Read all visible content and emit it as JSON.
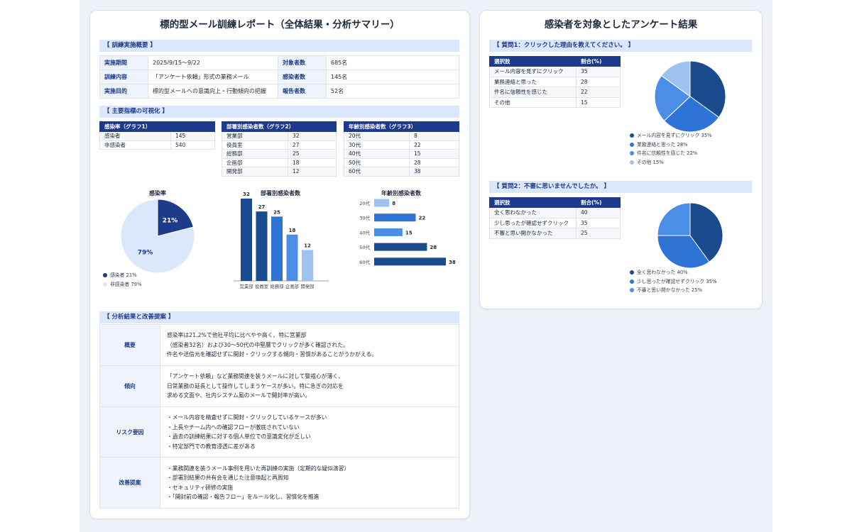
{
  "left": {
    "title": "標的型メール訓練レポート（全体結果・分析サマリー）",
    "overview": {
      "heading": "【 訓練実施概要 】",
      "rows": [
        {
          "k1": "実施期間",
          "v1": "2025/9/15〜9/22",
          "k2": "対象者数",
          "v2": "685名"
        },
        {
          "k1": "訓練内容",
          "v1": "「アンケート依頼」形式の業務メール",
          "k2": "感染者数",
          "v2": "145名"
        },
        {
          "k1": "実施目的",
          "v1": "標的型メールへの意識向上・行動傾向の把握",
          "k2": "報告者数",
          "v2": "52名"
        }
      ]
    },
    "indicators": {
      "heading": "【 主要指標の可視化 】",
      "t1": {
        "header": "感染率（グラフ1）",
        "rows": [
          [
            "感染者",
            "145"
          ],
          [
            "非感染者",
            "540"
          ]
        ]
      },
      "t2": {
        "header": "部署別感染者数（グラフ2）",
        "rows": [
          [
            "営業部",
            "32"
          ],
          [
            "役員室",
            "27"
          ],
          [
            "総務部",
            "25"
          ],
          [
            "企画部",
            "18"
          ],
          [
            "開発部",
            "12"
          ]
        ]
      },
      "t3": {
        "header": "年齢別感染者数（グラフ3）",
        "rows": [
          [
            "20代",
            "8"
          ],
          [
            "30代",
            "22"
          ],
          [
            "40代",
            "15"
          ],
          [
            "50代",
            "28"
          ],
          [
            "60代",
            "38"
          ]
        ]
      }
    },
    "pie_legend": [
      "感染者 21%",
      "非感染者 79%"
    ],
    "analysis": {
      "heading": "【 分析結果と改善提案 】",
      "rows": [
        {
          "k": "概要",
          "lines": [
            "感染率は21.2%で他社平均に比べやや高く、特に営業部",
            "（感染者32名）および30〜50代の中堅層でクリックが多く確認された。",
            "件名や送信元を確認せずに開封・クリックする傾向・習慣があることがうかがえる。"
          ]
        },
        {
          "k": "傾向",
          "lines": [
            "「アンケート依頼」など業務関連を装うメールに対して警戒心が薄く、",
            "日常業務の延長として操作してしまうケースが多い。特に急ぎの対応を",
            "求める文面や、社内システム風のメールで開封率が高い。"
          ]
        },
        {
          "k": "リスク要因",
          "lines": [
            "・メール内容を精査せずに開封・クリックしているケースが多い",
            "・上長やチーム内への確認フローが徹底されていない",
            "・過去の訓練結果に対する個人単位での意識変化が乏しい",
            "・特定部門での教育浸透に差がある"
          ]
        },
        {
          "k": "改善提案",
          "lines": [
            "・業務関連を装うメール事例を用いた再訓練の実施（定期的な疑似演習）",
            "・部署別結果の共有会を通じた注意喚起と再周知",
            "・セキュリティ研修の実施",
            "・「開封前の確認・報告フロー」をルール化し、習慣化を推進"
          ]
        }
      ]
    }
  },
  "right": {
    "title": "感染者を対象としたアンケート結果",
    "q1": {
      "heading": "【 質問1：クリックした理由を教えてください。 】",
      "cols": [
        "選択肢",
        "割合(%)"
      ],
      "rows": [
        [
          "メール内容を見ずにクリック",
          "35"
        ],
        [
          "業務連絡と思った",
          "28"
        ],
        [
          "件名に信頼性を感じた",
          "22"
        ],
        [
          "その他",
          "15"
        ]
      ],
      "legend": [
        "メール内容を見ずにクリック 35%",
        "業務連絡と思った 28%",
        "件名に信頼性を感じた 22%",
        "その他 15%"
      ]
    },
    "q2": {
      "heading": "【 質問2：不審に思いませんでしたか。 】",
      "cols": [
        "選択肢",
        "割合(%)"
      ],
      "rows": [
        [
          "全く思わなかった",
          "40"
        ],
        [
          "少し思ったが確認せずクリック",
          "35"
        ],
        [
          "不審と思い開かなかった",
          "25"
        ]
      ],
      "legend": [
        "全く思わなかった 40%",
        "少し思ったが確認せずクリック 35%",
        "不審と思い開かなかった 25%"
      ]
    }
  },
  "colors": {
    "navy": "#1e3a8a",
    "dark_blue": "#1a4b8f",
    "blue": "#2e74d6",
    "mid_blue": "#4a8ee6",
    "light_blue": "#9ec3f0",
    "pale_blue": "#dbe7fb"
  },
  "chart_data": [
    {
      "type": "pie",
      "title": "感染率",
      "labels": [
        "感染者",
        "非感染者"
      ],
      "values": [
        21,
        79
      ],
      "data_labels": [
        "21%",
        "79%"
      ]
    },
    {
      "type": "bar",
      "title": "部署別感染者数",
      "categories": [
        "営業部",
        "役員室",
        "総務部",
        "企画部",
        "開発部"
      ],
      "values": [
        32,
        27,
        25,
        18,
        12
      ]
    },
    {
      "type": "bar",
      "orientation": "horizontal",
      "title": "年齢別感染者数",
      "categories": [
        "20代",
        "30代",
        "40代",
        "50代",
        "60代"
      ],
      "values": [
        8,
        22,
        15,
        28,
        38
      ]
    },
    {
      "type": "pie",
      "labels": [
        "メール内容を見ずにクリック",
        "業務連絡と思った",
        "件名に信頼性を感じた",
        "その他"
      ],
      "values": [
        35,
        28,
        22,
        15
      ]
    },
    {
      "type": "pie",
      "labels": [
        "全く思わなかった",
        "少し思ったが確認せずクリック",
        "不審と思い開かなかった"
      ],
      "values": [
        40,
        35,
        25
      ]
    }
  ]
}
